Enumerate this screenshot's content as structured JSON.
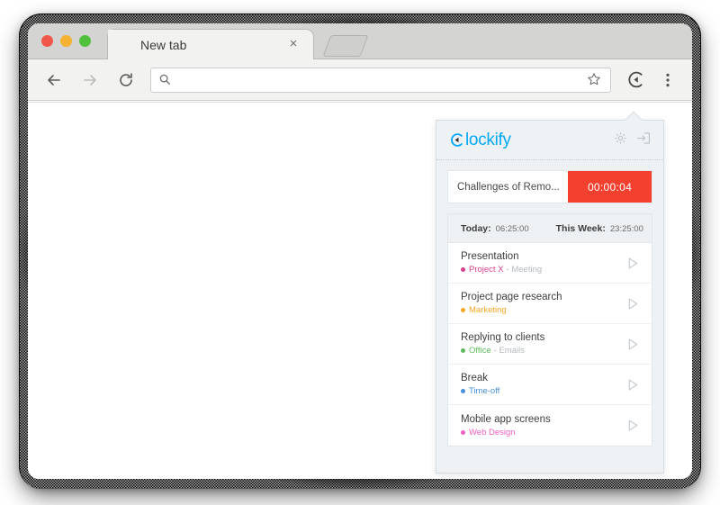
{
  "browser": {
    "window_controls": [
      "close",
      "minimize",
      "maximize"
    ],
    "tab": {
      "title": "New tab",
      "close_label": "×",
      "newtab_label": "New Tab"
    },
    "toolbar": {
      "back_icon": "back-arrow-icon",
      "forward_icon": "forward-arrow-icon",
      "reload_icon": "reload-icon",
      "search_icon": "search-icon",
      "url_value": "",
      "url_placeholder": "",
      "bookmark_icon": "star-icon",
      "extension_icon": "clockify-extension-icon",
      "menu_icon": "three-dot-menu-icon"
    }
  },
  "popup": {
    "logo_text": "lockify",
    "logo_mark": "clockify-logo-mark",
    "settings_icon": "gear-icon",
    "logout_icon": "logout-icon",
    "timer": {
      "description": "Challenges of Remo...",
      "elapsed": "00:00:04",
      "button_color": "#f4402e",
      "running": true
    },
    "totals": [
      {
        "label": "Today:",
        "value": "06:25:00"
      },
      {
        "label": "This Week:",
        "value": "23:25:00"
      }
    ],
    "entries": [
      {
        "title": "Presentation",
        "project": "Project X",
        "task": "- Meeting",
        "color": "#d6418c",
        "play_icon": "play-icon"
      },
      {
        "title": "Project page research",
        "project": "Marketing",
        "task": "",
        "color": "#f5a623",
        "play_icon": "play-icon"
      },
      {
        "title": "Replying to clients",
        "project": "Office",
        "task": "- Emails",
        "color": "#5fba5f",
        "play_icon": "play-icon"
      },
      {
        "title": "Break",
        "project": "Time-off",
        "task": "",
        "color": "#4a90d9",
        "play_icon": "play-icon"
      },
      {
        "title": "Mobile app screens",
        "project": "Web Design",
        "task": "",
        "color": "#ef5fc0",
        "play_icon": "play-icon"
      }
    ]
  }
}
